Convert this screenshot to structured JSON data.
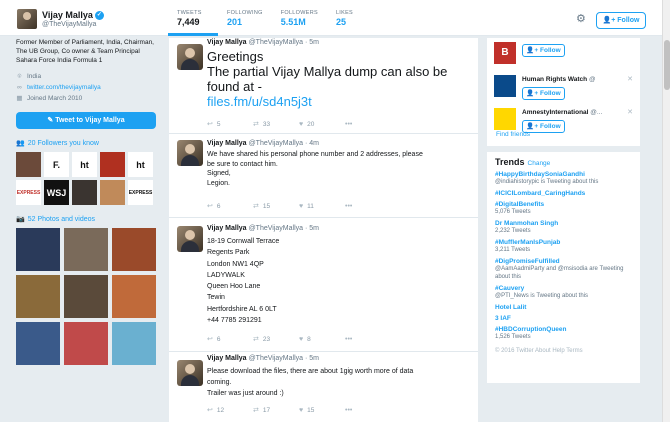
{
  "profile": {
    "name": "Vijay Mallya",
    "handle": "@TheVijayMallya",
    "bio": "Former Member of Parliament, India, Chairman, The UB Group, Co owner & Team Principal Sahara Force India Formula 1",
    "location": "India",
    "website": "twitter.com/thevijaymallya",
    "joined": "Joined March 2010",
    "tweet_to_label": "Tweet to Vijay Mallya"
  },
  "stats": [
    {
      "label": "TWEETS",
      "value": "7,449"
    },
    {
      "label": "FOLLOWING",
      "value": "201"
    },
    {
      "label": "FOLLOWERS",
      "value": "5.51M"
    },
    {
      "label": "LIKES",
      "value": "25"
    }
  ],
  "follow_label": "Follow",
  "followers_you_know": "20 Followers you know",
  "photos_videos": "52 Photos and videos",
  "followers_tiles": [
    {
      "label": "",
      "bg": "#6b4a3a",
      "fg": "#fff"
    },
    {
      "label": "F.",
      "bg": "#ffffff",
      "fg": "#111"
    },
    {
      "label": "ht",
      "bg": "#ffffff",
      "fg": "#111"
    },
    {
      "label": "",
      "bg": "#b03020",
      "fg": "#fff"
    },
    {
      "label": "ht",
      "bg": "#ffffff",
      "fg": "#111"
    },
    {
      "label": "EXPRESS",
      "bg": "#ffffff",
      "fg": "#c0302a"
    },
    {
      "label": "WSJ",
      "bg": "#111111",
      "fg": "#fff"
    },
    {
      "label": "",
      "bg": "#3a3430",
      "fg": "#fff"
    },
    {
      "label": "",
      "bg": "#c08a5a",
      "fg": "#fff"
    },
    {
      "label": "EXPRESS",
      "bg": "#ffffff",
      "fg": "#111"
    }
  ],
  "photo_tiles": [
    {
      "bg": "#2a3a5a"
    },
    {
      "bg": "#7a6a5a"
    },
    {
      "bg": "#9a4a2a"
    },
    {
      "bg": "#8a6a3a"
    },
    {
      "bg": "#5a4a3a"
    },
    {
      "bg": "#c06a3a"
    },
    {
      "bg": "#3a5a8a"
    },
    {
      "bg": "#c04a4a"
    },
    {
      "bg": "#6ab0d0"
    }
  ],
  "tweets": [
    {
      "name": "Vijay Mallya",
      "handle": "@TheVijayMallya · 5m",
      "lines": [
        "Greetings",
        "The partial Vijay Mallya dump can also be",
        "found at -"
      ],
      "link": "files.fm/u/sd4n5j3t",
      "actions": {
        "reply": "5",
        "retweet": "33",
        "like": "20"
      }
    },
    {
      "name": "Vijay Mallya",
      "handle": "@TheVijayMallya · 4m",
      "lines": [
        "We have shared his personal phone number and 2 addresses, please",
        "be sure to contact him.",
        "Signed,",
        "Legion."
      ],
      "actions": {
        "reply": "6",
        "retweet": "15",
        "like": "11"
      }
    },
    {
      "name": "Vijay Mallya",
      "handle": "@TheVijayMallya · 5m",
      "lines": [
        "18-19 Cornwall Terrace",
        "Regents Park",
        "London NW1 4QP",
        "LADYWALK",
        "Queen Hoo Lane",
        "Tewin",
        "Hertfordshire AL 6 0LT",
        "+44 7785 291291"
      ],
      "actions": {
        "reply": "6",
        "retweet": "23",
        "like": "8"
      }
    },
    {
      "name": "Vijay Mallya",
      "handle": "@TheVijayMallya · 5m",
      "lines": [
        "Please download the files, there are about 1gig worth more of data",
        "coming.",
        "Trailer was just around :)"
      ],
      "actions": {
        "reply": "12",
        "retweet": "17",
        "like": "15"
      }
    }
  ],
  "who_to_follow": [
    {
      "name": "",
      "handle": "",
      "bg": "#c0302a",
      "mark": "B"
    },
    {
      "name": "Human Rights Watch",
      "handle": "@",
      "bg": "#0a4a8a",
      "mark": "HRW"
    },
    {
      "name": "AmnestyInternational",
      "handle": "@...",
      "bg": "#ffd700",
      "mark": "A"
    }
  ],
  "find_friends": "Find friends",
  "trends": {
    "title": "Trends",
    "change": "Change",
    "items": [
      {
        "name": "#HappyBirthdaySoniaGandhi",
        "sub": "@indiahistorypic is Tweeting about this"
      },
      {
        "name": "#ICICILombard_CaringHands",
        "sub": ""
      },
      {
        "name": "#DigitalBenefits",
        "sub": "5,076 Tweets"
      },
      {
        "name": "Dr Manmohan Singh",
        "sub": "2,232 Tweets"
      },
      {
        "name": "#MufflerManIsPunjab",
        "sub": "3,211 Tweets"
      },
      {
        "name": "#DigPromiseFulfilled",
        "sub": "@AamAadmiParty and @msisodia are Tweeting about this"
      },
      {
        "name": "#Cauvery",
        "sub": "@PTI_News is Tweeting about this"
      },
      {
        "name": "Hotel Lalit",
        "sub": ""
      },
      {
        "name": "3 IAF",
        "sub": ""
      },
      {
        "name": "#HBDCorruptionQueen",
        "sub": "1,526 Tweets"
      }
    ]
  },
  "footer": "© 2016 Twitter  About  Help  Terms"
}
